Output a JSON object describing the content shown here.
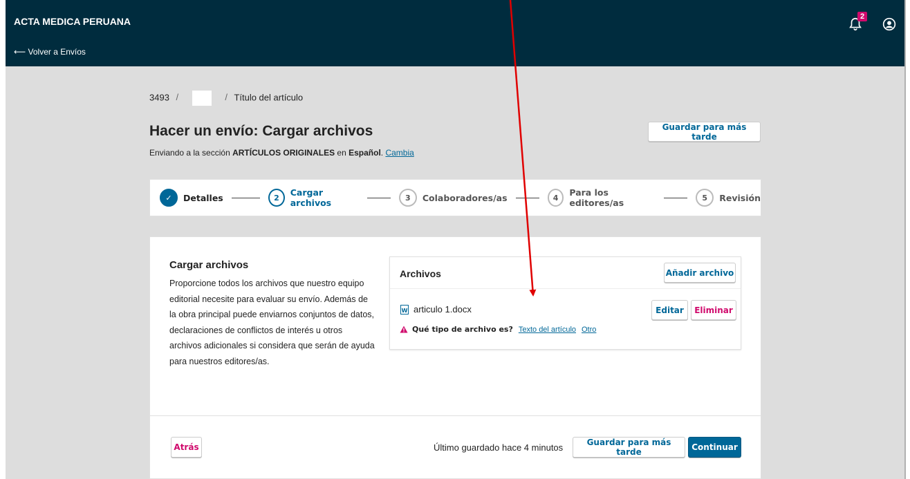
{
  "header": {
    "brand": "ACTA MEDICA PERUANA",
    "back_link": "⟵ Volver a Envíos",
    "notification_count": "2"
  },
  "breadcrumb": {
    "id": "3493",
    "sep1": "/",
    "sep2": "/",
    "title": "Título del artículo"
  },
  "page": {
    "title": "Hacer un envío: Cargar archivos",
    "subtitle_prefix": "Enviando a la sección ",
    "section": "ARTÍCULOS ORIGINALES",
    "subtitle_mid": " en ",
    "language": "Español",
    "subtitle_end": ". ",
    "change_link": "Cambia",
    "save_later": "Guardar para más tarde"
  },
  "steps": [
    {
      "num": "✓",
      "label": "Detalles"
    },
    {
      "num": "2",
      "label": "Cargar archivos"
    },
    {
      "num": "3",
      "label": "Colaboradores/as"
    },
    {
      "num": "4",
      "label": "Para los editores/as"
    },
    {
      "num": "5",
      "label": "Revisión"
    }
  ],
  "upload": {
    "title": "Cargar archivos",
    "description": "Proporcione todos los archivos que nuestro equipo editorial necesite para evaluar su envío. Además de la obra principal puede enviarnos conjuntos de datos, declaraciones de conflictos de interés u otros archivos adicionales si considera que serán de ayuda para nuestros editores/as."
  },
  "files": {
    "title": "Archivos",
    "add_button": "Añadir archivo",
    "items": [
      {
        "name": "articulo 1.docx",
        "edit": "Editar",
        "delete": "Eliminar"
      }
    ],
    "type_question": "Qué tipo de archivo es?",
    "type_option_1": "Texto del artículo",
    "type_option_2": "Otro"
  },
  "footer": {
    "back": "Atrás",
    "last_saved": "Último guardado hace 4 minutos",
    "save_later": "Guardar para más tarde",
    "continue": "Continuar"
  },
  "colors": {
    "header_bg": "#002c3e",
    "accent": "#006798",
    "danger": "#d00a6c",
    "annotation_arrow": "#e00000"
  }
}
